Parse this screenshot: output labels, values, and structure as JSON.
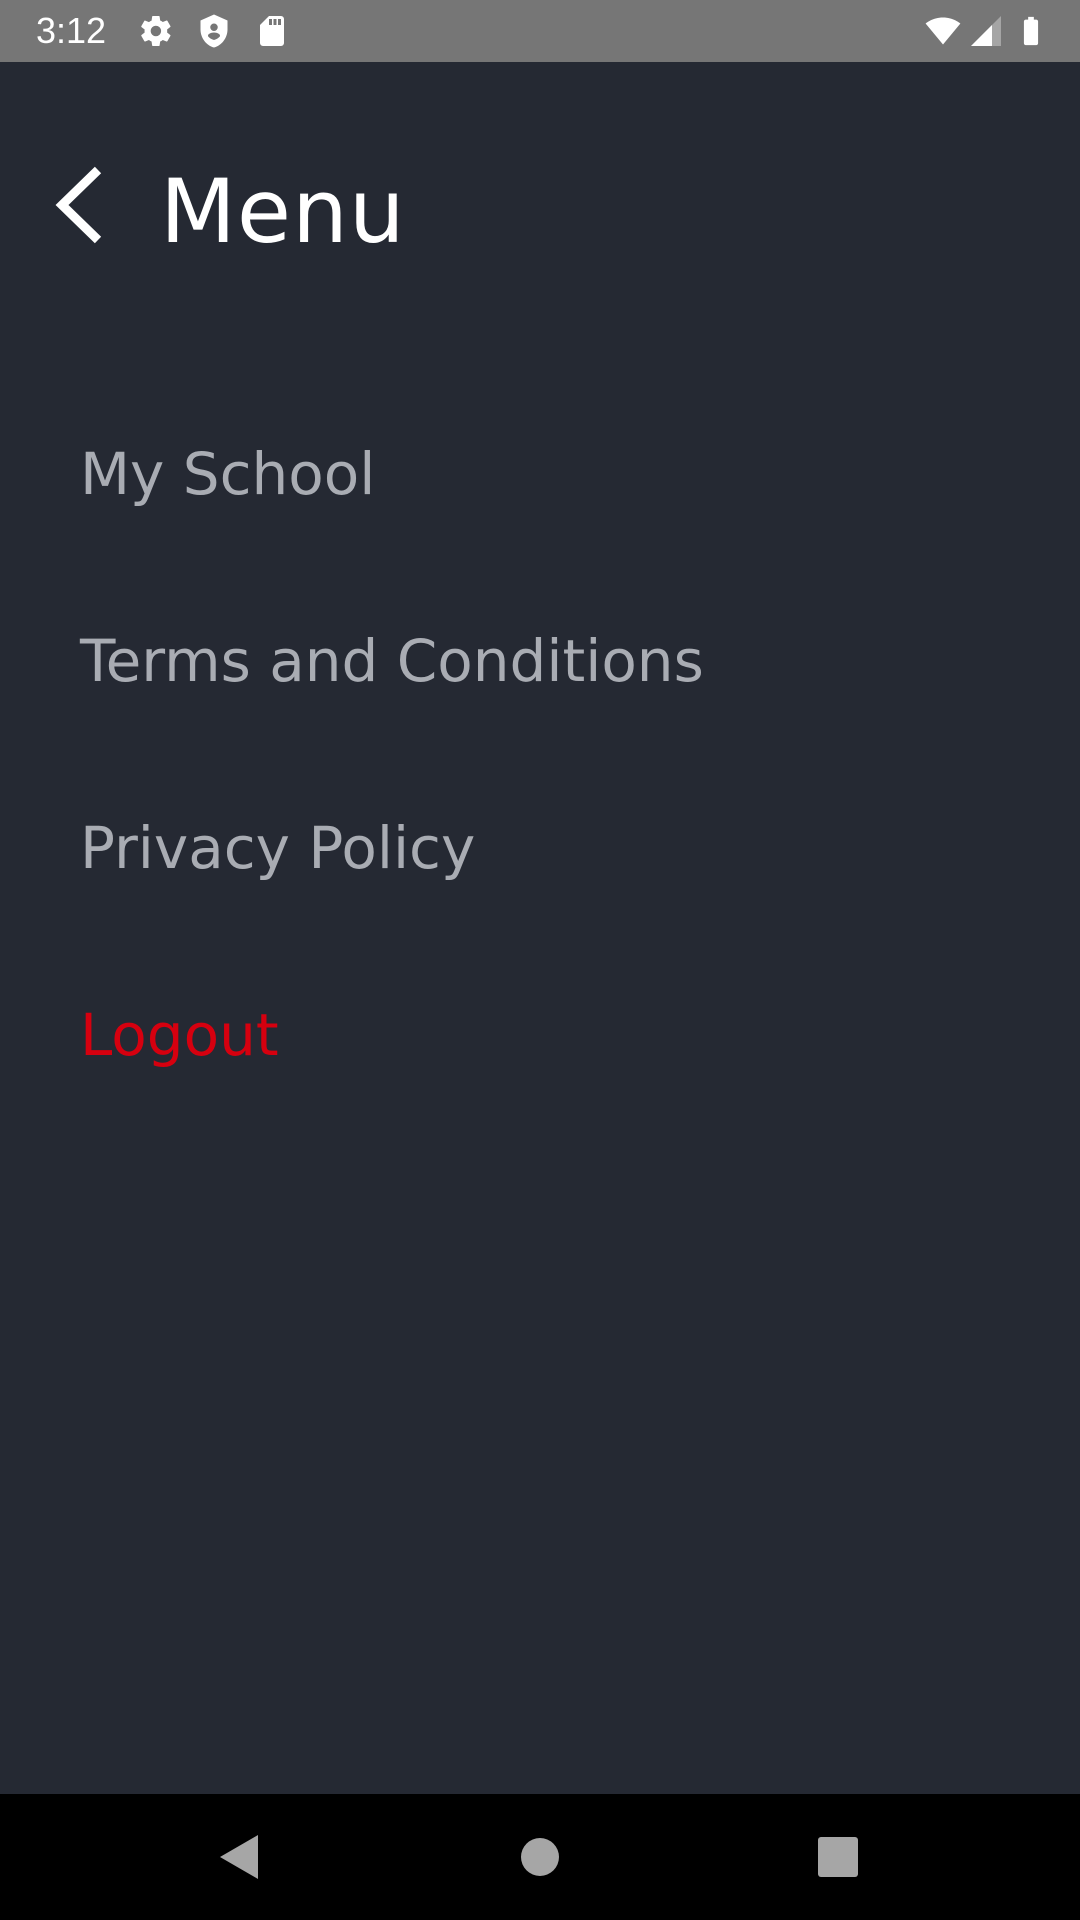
{
  "status_bar": {
    "time": "3:12",
    "icons": [
      "settings-icon",
      "shield-icon",
      "sd-card-icon",
      "wifi-icon",
      "cell-signal-icon",
      "battery-icon"
    ]
  },
  "header": {
    "title": "Menu",
    "back_icon": "chevron-left-icon"
  },
  "menu": {
    "items": [
      {
        "label": "My School"
      },
      {
        "label": "Terms and Conditions"
      },
      {
        "label": "Privacy Policy"
      },
      {
        "label": "Logout"
      }
    ]
  },
  "nav_bar": {
    "icons": [
      "back-triangle-icon",
      "home-circle-icon",
      "recents-square-icon"
    ]
  },
  "colors": {
    "background": "#252933",
    "status_bar": "#767676",
    "menu_text": "#a9acb3",
    "logout": "#d6000f",
    "title": "#ffffff",
    "nav_bar": "#000000"
  }
}
